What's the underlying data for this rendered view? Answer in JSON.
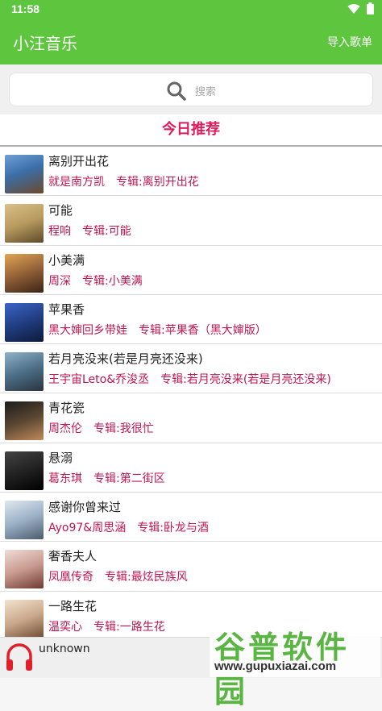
{
  "status": {
    "time": "11:58"
  },
  "header": {
    "title": "小汪音乐",
    "action": "导入歌单"
  },
  "search": {
    "placeholder": "搜索"
  },
  "recommend": {
    "title": "今日推荐"
  },
  "songs": [
    {
      "title": "离别开出花",
      "artist": "就是南方凯",
      "album": "专辑:离别开出花",
      "cover": "#3b6ea8"
    },
    {
      "title": "可能",
      "artist": "程响",
      "album": "专辑:可能",
      "cover": "#b79a5e"
    },
    {
      "title": "小美满",
      "artist": "周深",
      "album": "专辑:小美满",
      "cover": "#8a5a35"
    },
    {
      "title": "苹果香",
      "artist": "黑大婶回乡带娃",
      "album": "专辑:苹果香（黑大婶版）",
      "cover": "#1f3a7a"
    },
    {
      "title": "若月亮没来(若是月亮还没来)",
      "artist": "王宇宙Leto&乔浚丞",
      "album": "专辑:若月亮没来(若是月亮还没来)",
      "cover": "#4c6e86"
    },
    {
      "title": "青花瓷",
      "artist": "周杰伦",
      "album": "专辑:我很忙",
      "cover": "#5a4632"
    },
    {
      "title": "悬溺",
      "artist": "葛东琪",
      "album": "专辑:第二街区",
      "cover": "#222222"
    },
    {
      "title": "感谢你曾来过",
      "artist": "Ayo97&周思涵",
      "album": "专辑:卧龙与酒",
      "cover": "#9bb0c6"
    },
    {
      "title": "奢香夫人",
      "artist": "凤凰传奇",
      "album": "专辑:最炫民族风",
      "cover": "#c89a90"
    },
    {
      "title": "一路生花",
      "artist": "温奕心",
      "album": "专辑:一路生花",
      "cover": "#caa98c"
    }
  ],
  "player": {
    "track": "unknown"
  },
  "watermark": {
    "name": "谷普软件园",
    "url": "www.gupuxiazai.com"
  },
  "colors": {
    "primary": "#5ec53f",
    "accent": "#e01a5a",
    "meta": "#c0154f"
  }
}
